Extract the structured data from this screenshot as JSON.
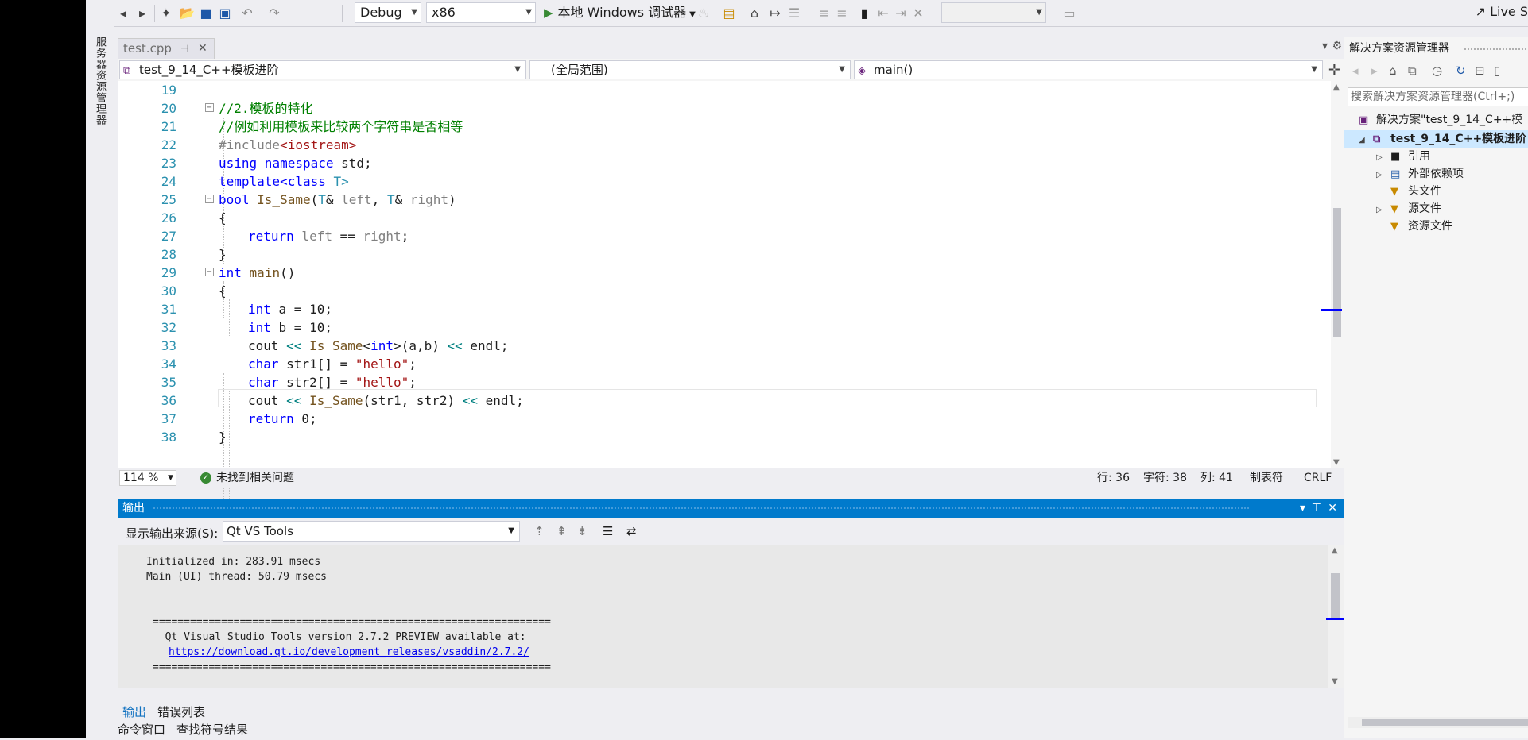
{
  "side_tab": {
    "label": "服务器资源管理器"
  },
  "toolbar": {
    "config": "Debug",
    "platform": "x86",
    "run_label": "本地 Windows 调试器",
    "live_share": "Live S"
  },
  "doc_tab": {
    "filename": "test.cpp"
  },
  "nav": {
    "project": "test_9_14_C++模板进阶",
    "scope": "(全局范围)",
    "member": "main()"
  },
  "code_lines": [
    {
      "n": "19"
    },
    {
      "n": "20"
    },
    {
      "n": "21"
    },
    {
      "n": "22"
    },
    {
      "n": "23"
    },
    {
      "n": "24"
    },
    {
      "n": "25"
    },
    {
      "n": "26"
    },
    {
      "n": "27"
    },
    {
      "n": "28"
    },
    {
      "n": "29"
    },
    {
      "n": "30"
    },
    {
      "n": "31"
    },
    {
      "n": "32"
    },
    {
      "n": "33"
    },
    {
      "n": "34"
    },
    {
      "n": "35"
    },
    {
      "n": "36"
    },
    {
      "n": "37"
    },
    {
      "n": "38"
    }
  ],
  "code_text": {
    "l20": "//2.模板的特化",
    "l21": "//例如利用模板来比较两个字符串是否相等",
    "l22a": "#include",
    "l22b": "<iostream>",
    "l23a": "using",
    "l23b": " namespace",
    "l23c": " std;",
    "l24a": "template",
    "l24b": "<class",
    "l24c": " T>",
    "l25a": "bool",
    "l25b": " Is_Same",
    "l25c": "(",
    "l25d": "T",
    "l25e": "& ",
    "l25f": "left",
    "l25g": ", ",
    "l25h": "T",
    "l25i": "& ",
    "l25j": "right",
    "l25k": ")",
    "l26": "{",
    "l27a": "return",
    "l27b": " left",
    "l27c": " == ",
    "l27d": "right",
    "l27e": ";",
    "l28": "}",
    "l29a": "int",
    "l29b": " main",
    "l29c": "()",
    "l30": "{",
    "l31a": "int",
    "l31b": " a = 10;",
    "l32a": "int",
    "l32b": " b = 10;",
    "l33a": "cout ",
    "l33b": "<<",
    "l33c": " Is_Same",
    "l33d": "<",
    "l33e": "int",
    "l33f": ">",
    "l33g": "(a,b) ",
    "l33h": "<<",
    "l33i": " endl;",
    "l34a": "char",
    "l34b": " str1[] = ",
    "l34c": "\"hello\"",
    "l34d": ";",
    "l35a": "char",
    "l35b": " str2[] = ",
    "l35c": "\"hello\"",
    "l35d": ";",
    "l36a": "cout ",
    "l36b": "<<",
    "l36c": " Is_Same",
    "l36d": "(str1, str2) ",
    "l36e": "<<",
    "l36f": " endl;",
    "l37a": "return",
    "l37b": " 0;",
    "l38": "}"
  },
  "status": {
    "zoom": "114 %",
    "issues": "未找到相关问题",
    "line": "行: 36",
    "char": "字符: 38",
    "col": "列: 41",
    "tabs": "制表符",
    "eol": "CRLF"
  },
  "output": {
    "title": "输出",
    "source_label": "显示输出来源(S):",
    "source_value": "Qt VS Tools",
    "lines": {
      "init": "Initialized in: 283.91 msecs",
      "main": "Main (UI) thread: 50.79 msecs",
      "sep1": "================================================================",
      "version": "  Qt Visual Studio Tools version 2.7.2 PREVIEW available at:",
      "link": "https://download.qt.io/development_releases/vsaddin/2.7.2/",
      "sep2": "================================================================"
    }
  },
  "bottom_tabs": {
    "output": "输出",
    "errors": "错误列表",
    "command": "命令窗口",
    "find_symbol": "查找符号结果"
  },
  "solution_explorer": {
    "title": "解决方案资源管理器",
    "search_placeholder": "搜索解决方案资源管理器(Ctrl+;)",
    "solution": "解决方案\"test_9_14_C++模",
    "project": "test_9_14_C++模板进阶",
    "items": [
      "引用",
      "外部依赖项",
      "头文件",
      "源文件",
      "资源文件"
    ]
  },
  "colors": {
    "accent": "#007acc",
    "keyword": "#0000ff",
    "comment": "#008000",
    "type": "#2b91af",
    "string": "#a31515"
  }
}
